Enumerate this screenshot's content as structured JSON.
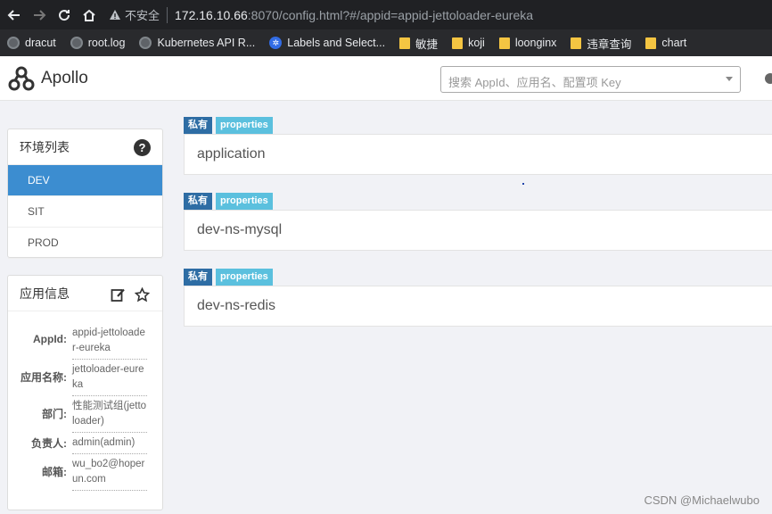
{
  "browser": {
    "security_label": "不安全",
    "url_host": "172.16.10.66",
    "url_rest": ":8070/config.html?#/appid=appid-jettoloader-eureka",
    "bookmarks": [
      {
        "label": "dracut",
        "icon": "globe-icon"
      },
      {
        "label": "root.log",
        "icon": "globe-icon"
      },
      {
        "label": "Kubernetes API R...",
        "icon": "globe-icon"
      },
      {
        "label": "Labels and Select...",
        "icon": "kubernetes-icon"
      },
      {
        "label": "敏捷",
        "icon": "folder-icon"
      },
      {
        "label": "koji",
        "icon": "folder-icon"
      },
      {
        "label": "loonginx",
        "icon": "folder-icon"
      },
      {
        "label": "违章查询",
        "icon": "folder-icon"
      },
      {
        "label": "chart",
        "icon": "folder-icon"
      }
    ]
  },
  "header": {
    "logo_text": "Apollo",
    "search_placeholder": "搜索 AppId、应用名、配置项 Key"
  },
  "env_panel": {
    "title": "环境列表",
    "items": [
      "DEV",
      "SIT",
      "PROD"
    ],
    "active_index": 0
  },
  "info_panel": {
    "title": "应用信息",
    "rows": [
      {
        "key": "AppId:",
        "value": "appid-jettoloader-eureka"
      },
      {
        "key": "应用名称:",
        "value": "jettoloader-eureka"
      },
      {
        "key": "部门:",
        "value": "性能测试组(jettoloader)"
      },
      {
        "key": "负责人:",
        "value": "admin(admin)"
      },
      {
        "key": "邮箱:",
        "value": "wu_bo2@hoperun.com"
      }
    ]
  },
  "namespaces": [
    {
      "tag_scope": "私有",
      "tag_format": "properties",
      "name": "application"
    },
    {
      "tag_scope": "私有",
      "tag_format": "properties",
      "name": "dev-ns-mysql"
    },
    {
      "tag_scope": "私有",
      "tag_format": "properties",
      "name": "dev-ns-redis"
    }
  ],
  "watermark": "CSDN @Michaelwubo",
  "colors": {
    "active_env": "#3c8dd0",
    "tag_private": "#2e6da4",
    "tag_properties": "#5bc0de"
  }
}
